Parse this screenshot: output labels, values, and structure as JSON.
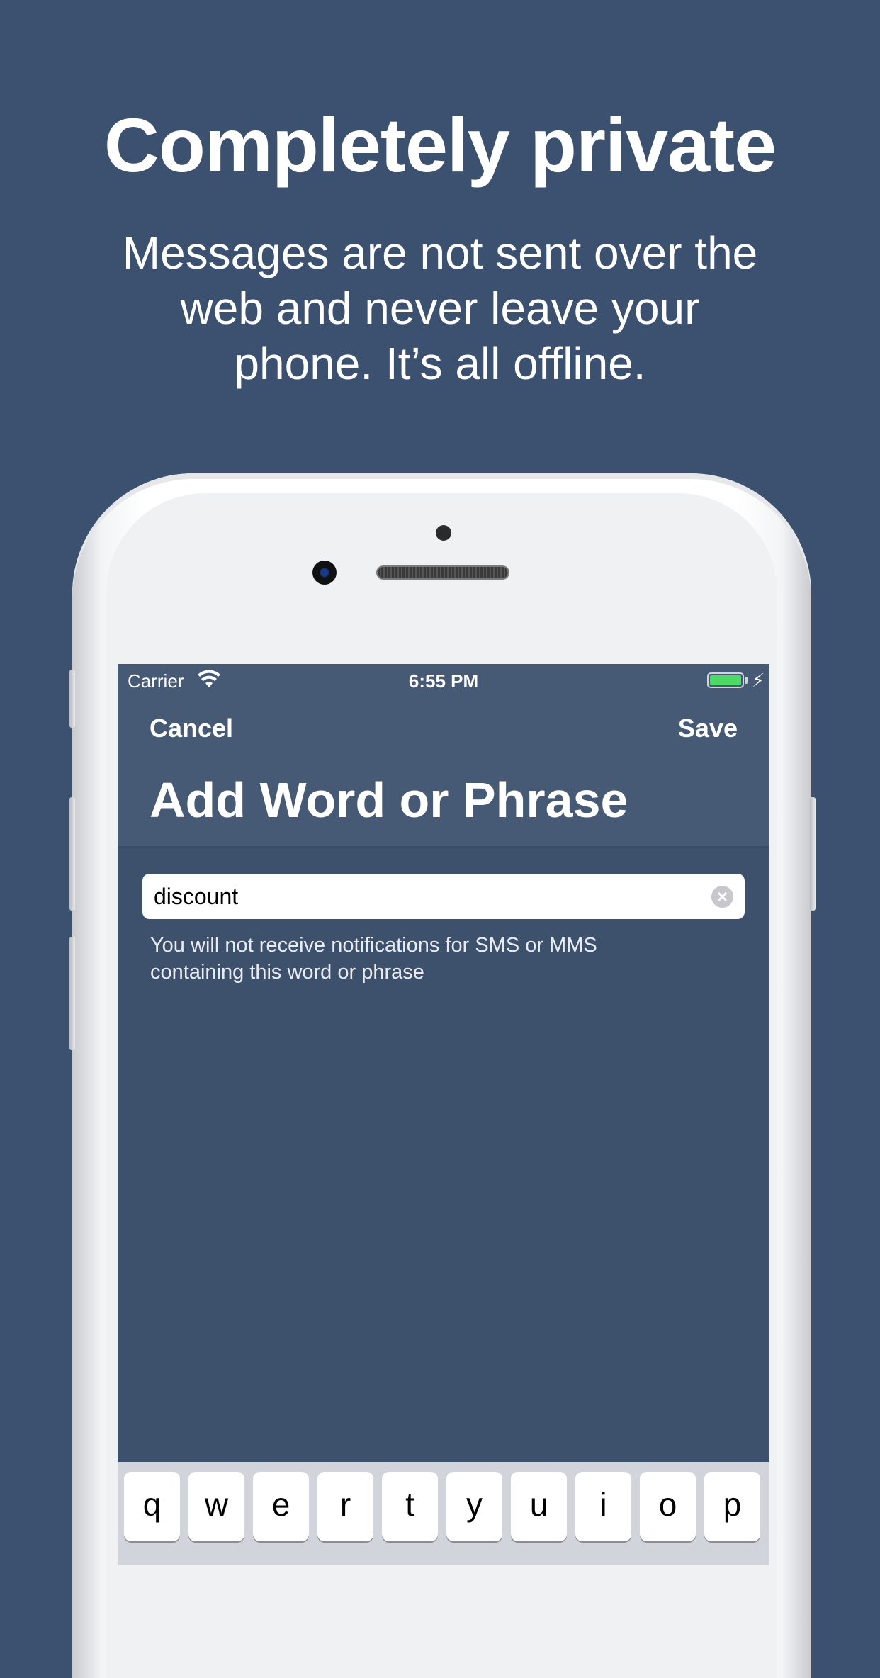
{
  "headline": "Completely private",
  "subtitle": "Messages are not sent over the\nweb and never leave your\nphone.  It’s all offline.",
  "status_bar": {
    "carrier": "Carrier",
    "time": "6:55 PM"
  },
  "nav": {
    "cancel_label": "Cancel",
    "save_label": "Save",
    "title": "Add Word or Phrase"
  },
  "field": {
    "value": "discount"
  },
  "hint": "You will not receive notifications for SMS or MMS containing this word or phrase",
  "keyboard": {
    "row1": [
      "q",
      "w",
      "e",
      "r",
      "t",
      "y",
      "u",
      "i",
      "o",
      "p"
    ]
  },
  "colors": {
    "background": "#3c5170",
    "navbar": "#475a75",
    "screen": "#3d506c",
    "battery_fill": "#4cd964"
  },
  "icons": {
    "wifi": "wifi-icon",
    "battery": "battery-icon",
    "charging": "charging-bolt-icon",
    "clear": "clear-text-icon"
  }
}
